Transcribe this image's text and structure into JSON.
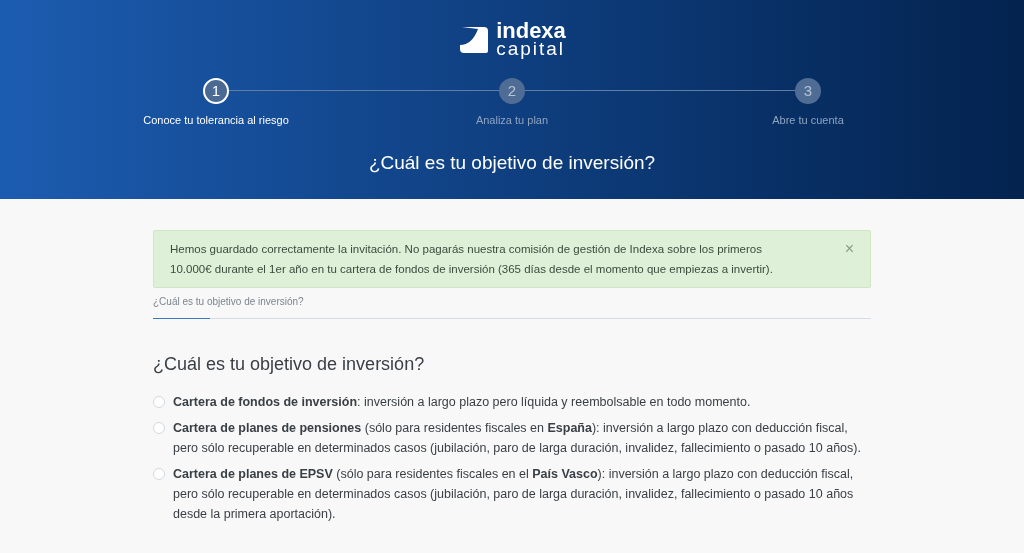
{
  "logo": {
    "line_1": "indexa",
    "line_2": "capital"
  },
  "steps": [
    {
      "number": "1",
      "label": "Conoce tu tolerancia al riesgo",
      "selected": true
    },
    {
      "number": "2",
      "label": "Analiza tu plan",
      "selected": false
    },
    {
      "number": "3",
      "label": "Abre tu cuenta",
      "selected": false
    }
  ],
  "header_title": "¿Cuál es tu objetivo de inversión?",
  "alert": {
    "text": "Hemos guardado correctamente la invitación. No pagarás nuestra comisión de gestión de Indexa sobre los primeros 10.000€ durante el 1er año en tu cartera de fondos de inversión (365 días desde el momento que empiezas a invertir).",
    "close": "×"
  },
  "tab": {
    "label": "¿Cuál es tu objetivo de inversión?",
    "level": 0.08
  },
  "question": "¿Cuál es tu objetivo de inversión?",
  "options": [
    {
      "text": "**Cartera de fondos de inversión**: inversión a largo plazo pero líquida y reembolsable en todo momento.",
      "selected": false
    },
    {
      "text": "**Cartera de planes de pensiones** (sólo para residentes fiscales en **España**): inversión a largo plazo con deducción fiscal, pero sólo recuperable en determinados casos (jubilación, paro de larga duración, invalidez, fallecimiento o pasado 10 años).",
      "selected": false
    },
    {
      "text": "**Cartera de planes de EPSV** (sólo para residentes fiscales en el **País Vasco**): inversión a largo plazo con deducción fiscal, pero sólo recuperable en determinados casos (jubilación, paro de larga duración, invalidez, fallecimiento o pasado 10 años desde la primera aportación).",
      "selected": false
    }
  ]
}
